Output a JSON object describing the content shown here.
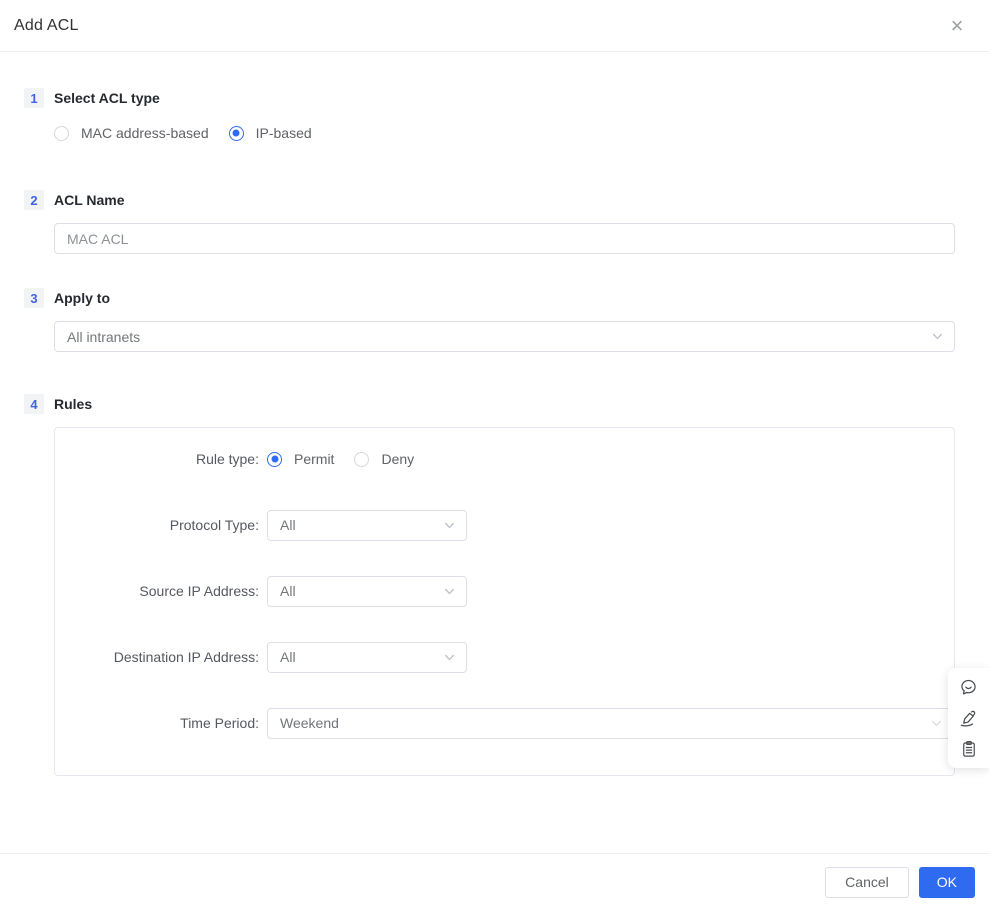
{
  "dialog": {
    "title": "Add ACL"
  },
  "steps": [
    {
      "number": "1",
      "heading": "Select ACL type"
    },
    {
      "number": "2",
      "heading": "ACL Name"
    },
    {
      "number": "3",
      "heading": "Apply to"
    },
    {
      "number": "4",
      "heading": "Rules"
    }
  ],
  "acl_type": {
    "options": [
      {
        "label": "MAC address-based",
        "selected": false
      },
      {
        "label": "IP-based",
        "selected": true
      }
    ]
  },
  "acl_name": {
    "value": "MAC ACL"
  },
  "apply_to": {
    "value": "All intranets"
  },
  "rules": {
    "rule_type": {
      "label": "Rule type:",
      "options": [
        {
          "label": "Permit",
          "selected": true
        },
        {
          "label": "Deny",
          "selected": false
        }
      ]
    },
    "fields": [
      {
        "label": "Protocol Type:",
        "value": "All"
      },
      {
        "label": "Source IP Address:",
        "value": "All"
      },
      {
        "label": "Destination IP Address:",
        "value": "All"
      },
      {
        "label": "Time Period:",
        "value": "Weekend"
      }
    ]
  },
  "footer": {
    "cancel_label": "Cancel",
    "ok_label": "OK"
  },
  "side_panel": {
    "icons": [
      "chat-smile-icon",
      "signature-pen-icon",
      "clipboard-icon"
    ]
  },
  "colors": {
    "accent": "#2e6bf0",
    "step_number": "#4262e1",
    "input_border": "#dcdfe6",
    "box_border": "#e4e7ed"
  }
}
